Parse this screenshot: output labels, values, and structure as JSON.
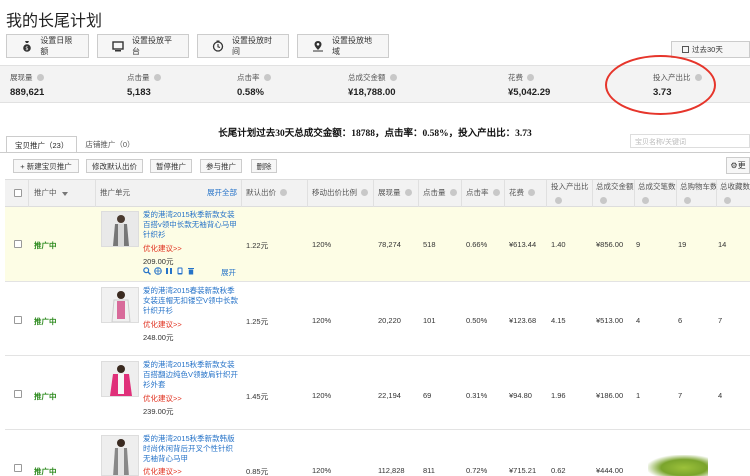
{
  "page_title": "我的长尾计划",
  "settings": [
    {
      "label": "设置日限额",
      "icon": "money-bag-icon"
    },
    {
      "label": "设置投放平台",
      "icon": "monitor-icon"
    },
    {
      "label": "设置投放时间",
      "icon": "clock-icon"
    },
    {
      "label": "设置投放地域",
      "icon": "map-pin-icon"
    }
  ],
  "period": "过去30天",
  "metrics": [
    {
      "label": "展现量",
      "value": "889,621"
    },
    {
      "label": "点击量",
      "value": "5,183"
    },
    {
      "label": "点击率",
      "value": "0.58%"
    },
    {
      "label": "总成交金额",
      "value": "¥18,788.00"
    },
    {
      "label": "花费",
      "value": "¥5,042.29"
    },
    {
      "label": "投入产出比",
      "value": "3.73"
    }
  ],
  "summary": "长尾计划过去30天总成交金额：18788，点击率：0.58%，投入产出比：3.73",
  "tabs": [
    {
      "label": "宝贝推广（23）"
    },
    {
      "label": "店铺推广（0）"
    }
  ],
  "search_placeholder": "宝贝名称/关键词",
  "toolbar": {
    "new": "+ 新建宝贝推广",
    "edit_bid": "修改默认出价",
    "pause": "暂停推广",
    "join": "参与推广",
    "delete": "删除",
    "gear": "更"
  },
  "columns": {
    "status": "推广中",
    "unit": "推广单元",
    "expand_all": "展开全部",
    "default_bid": "默认出价",
    "mobile_bid": "移动出价比例",
    "impressions": "展现量",
    "clicks": "点击量",
    "ctr": "点击率",
    "cost": "花费",
    "roi": "投入产出比",
    "gmv": "总成交金额",
    "orders": "总成交笔数",
    "carts": "总购物车数",
    "favs": "总收藏数"
  },
  "rows": [
    {
      "status": "推广中",
      "title": "爱的港湾2015秋季新款女装百搭v领中长款无袖背心马甲针织衫",
      "advice": "优化建议>>",
      "price": "209.00元",
      "expand": "展开",
      "bid": "1.22元",
      "mobile": "120%",
      "impressions": "78,274",
      "clicks": "518",
      "ctr": "0.66%",
      "cost": "¥613.44",
      "roi": "1.40",
      "gmv": "¥856.00",
      "orders": "9",
      "carts": "19",
      "favs": "14"
    },
    {
      "status": "推广中",
      "title": "爱的港湾2015春装新款秋季女装连帽无扣镂空V领中长款针织开衫",
      "advice": "优化建议>>",
      "price": "248.00元",
      "bid": "1.25元",
      "mobile": "120%",
      "impressions": "20,220",
      "clicks": "101",
      "ctr": "0.50%",
      "cost": "¥123.68",
      "roi": "4.15",
      "gmv": "¥513.00",
      "orders": "4",
      "carts": "6",
      "favs": "7"
    },
    {
      "status": "推广中",
      "title": "爱的港湾2015秋季新款女装百搭翻边纯色V领披肩针织开衫外套",
      "advice": "优化建议>>",
      "price": "239.00元",
      "bid": "1.45元",
      "mobile": "120%",
      "impressions": "22,194",
      "clicks": "69",
      "ctr": "0.31%",
      "cost": "¥94.80",
      "roi": "1.96",
      "gmv": "¥186.00",
      "orders": "1",
      "carts": "7",
      "favs": "4"
    },
    {
      "status": "推广中",
      "title": "爱的港湾2015秋季新款韩版时尚休闲背后开叉个性针织无袖背心马甲",
      "advice": "优化建议>>",
      "price": "",
      "bid": "0.85元",
      "mobile": "120%",
      "impressions": "112,828",
      "clicks": "811",
      "ctr": "0.72%",
      "cost": "¥715.21",
      "roi": "0.62",
      "gmv": "¥444.00",
      "orders": "",
      "carts": "",
      "favs": ""
    }
  ]
}
